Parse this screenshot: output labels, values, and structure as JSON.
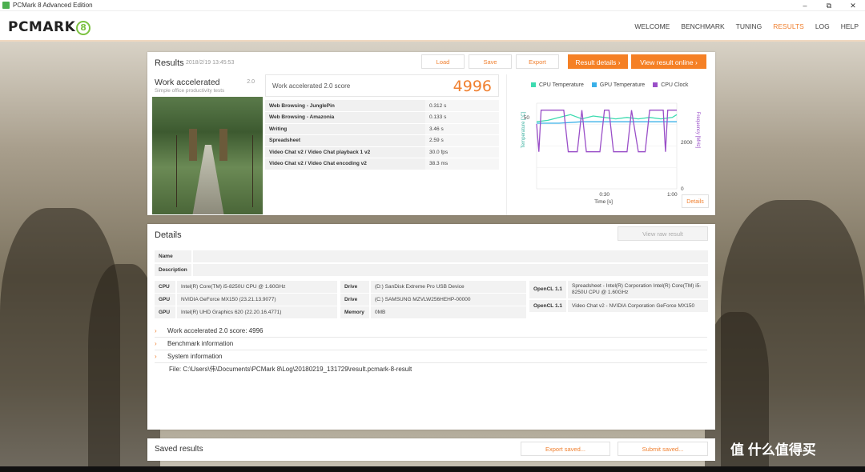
{
  "window": {
    "title": "PCMark 8 Advanced Edition",
    "min": "–",
    "max": "⧉",
    "close": "✕"
  },
  "header": {
    "logo_text": "PCMARK",
    "logo_num": "8",
    "nav": [
      "WELCOME",
      "BENCHMARK",
      "TUNING",
      "RESULTS",
      "LOG",
      "HELP"
    ],
    "active_nav": "RESULTS"
  },
  "results": {
    "title": "Results",
    "timestamp": "2018/2/19 13:45:53",
    "buttons": {
      "load": "Load",
      "save": "Save",
      "export": "Export",
      "details": "Result details",
      "online": "View result online"
    },
    "test": {
      "name": "Work accelerated",
      "version": "2.0",
      "subtitle": "Simple office productivity tests"
    },
    "score_label": "Work accelerated 2.0 score",
    "score": "4996",
    "subtests": [
      {
        "name": "Web Browsing - JunglePin",
        "value": "0.312 s"
      },
      {
        "name": "Web Browsing - Amazonia",
        "value": "0.133 s"
      },
      {
        "name": "Writing",
        "value": "3.46 s"
      },
      {
        "name": "Spreadsheet",
        "value": "2.59 s"
      },
      {
        "name": "Video Chat v2 / Video Chat playback 1 v2",
        "value": "30.0 fps"
      },
      {
        "name": "Video Chat v2 / Video Chat encoding v2",
        "value": "38.3 ms"
      }
    ],
    "chart_details_button": "Details"
  },
  "chart_data": {
    "type": "line",
    "title": "",
    "xlabel": "Time [s]",
    "ylabel_left": "Temperature [°C]",
    "ylabel_right": "Frequency [MHz]",
    "x_ticks": [
      "0:30",
      "1:00"
    ],
    "y_left_ticks": [
      "50"
    ],
    "y_right_ticks": [
      "0",
      "2000"
    ],
    "legend_position": "top",
    "series": [
      {
        "name": "CPU Temperature",
        "color": "#3ddbb0",
        "x": [
          0,
          5,
          10,
          15,
          20,
          25,
          30,
          35,
          40,
          45,
          50,
          55,
          60,
          62
        ],
        "values": [
          47,
          48,
          50,
          52,
          49,
          51,
          50,
          49,
          50,
          49,
          50,
          49,
          50,
          52
        ]
      },
      {
        "name": "GPU Temperature",
        "color": "#3ab0e8",
        "x": [
          0,
          10,
          20,
          30,
          40,
          50,
          60,
          62
        ],
        "values": [
          46,
          46,
          47,
          47,
          47,
          47,
          47,
          47
        ]
      },
      {
        "name": "CPU Clock",
        "color": "#9a4fc8",
        "x": [
          0,
          1,
          2,
          3,
          12,
          14,
          18,
          20,
          22,
          24,
          28,
          30,
          32,
          34,
          40,
          42,
          45,
          46,
          48,
          50,
          56,
          57,
          58,
          60,
          62
        ],
        "values": [
          2800,
          1600,
          3400,
          3400,
          3400,
          1600,
          1600,
          3400,
          1600,
          1600,
          1600,
          3400,
          3400,
          1600,
          1600,
          3400,
          1600,
          1600,
          1600,
          3400,
          3400,
          1600,
          3400,
          3400,
          3400
        ]
      }
    ],
    "x_range": [
      0,
      62
    ],
    "y_left_range": [
      0,
      60
    ],
    "y_right_range": [
      0,
      3700
    ]
  },
  "details": {
    "title": "Details",
    "raw_button": "View raw result",
    "name_label": "Name",
    "desc_label": "Description",
    "hardware": [
      {
        "k": "CPU",
        "v": "Intel(R) Core(TM) i5-8250U CPU @ 1.60GHz"
      },
      {
        "k": "GPU",
        "v": "NVIDIA GeForce MX150 (23.21.13.9077)"
      },
      {
        "k": "GPU",
        "v": "Intel(R) UHD Graphics 620 (22.20.16.4771)"
      }
    ],
    "drives": [
      {
        "k": "Drive",
        "v": "(D:) SanDisk Extreme Pro USB Device"
      },
      {
        "k": "Drive",
        "v": "(C:) SAMSUNG MZVLW256HEHP-00000"
      },
      {
        "k": "Memory",
        "v": "0MB"
      }
    ],
    "opencl": [
      {
        "k": "OpenCL 1.1",
        "v": "Spreadsheet - Intel(R) Corporation Intel(R) Core(TM) i5-8250U CPU @ 1.60GHz"
      },
      {
        "k": "OpenCL 1.1",
        "v": "Video Chat v2 - NVIDIA Corporation GeForce MX150"
      }
    ],
    "rows": [
      "Work accelerated 2.0 score: 4996",
      "Benchmark information",
      "System information"
    ],
    "file": "File: C:\\Users\\伟\\Documents\\PCMark 8\\Log\\20180219_131729\\result.pcmark-8-result"
  },
  "saved": {
    "title": "Saved results",
    "export": "Export saved...",
    "submit": "Submit saved..."
  },
  "watermark": "值 什么值得买"
}
